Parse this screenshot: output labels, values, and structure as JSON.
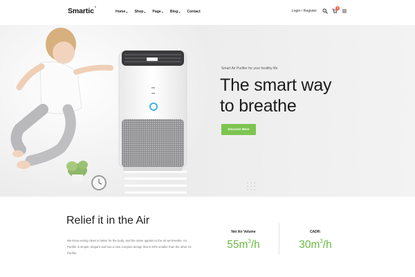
{
  "header": {
    "logo": "Smartic",
    "logo_mark": "°",
    "nav": [
      {
        "label": "Home",
        "dropdown": true
      },
      {
        "label": "Shop",
        "dropdown": true
      },
      {
        "label": "Page",
        "dropdown": true
      },
      {
        "label": "Blog",
        "dropdown": true
      },
      {
        "label": "Contact",
        "dropdown": false
      }
    ],
    "login_label": "Login / Register",
    "cart_count": "0",
    "icons": [
      "search-icon",
      "cart-icon",
      "menu-icon"
    ]
  },
  "hero": {
    "tagline": "Smart Air Purifier for your healthy life",
    "headline_line1": "The smart way",
    "headline_line2": "to breathe",
    "button_label": "Discover More",
    "accent_color": "#7dc450"
  },
  "relief": {
    "title": "Relief it in the Air",
    "text": "We know eating clean is better for the body, and the same applies to the air we breathe. Air Purifier is simple, elegant and has a new compact design that is 40% smaller than the other Air Purifier."
  },
  "stats": [
    {
      "label": "Net Air Volume",
      "value": "55m",
      "sup": "3",
      "unit": "/h"
    },
    {
      "label": "CADR:",
      "value": "30m",
      "sup": "3",
      "unit": "/h"
    }
  ]
}
